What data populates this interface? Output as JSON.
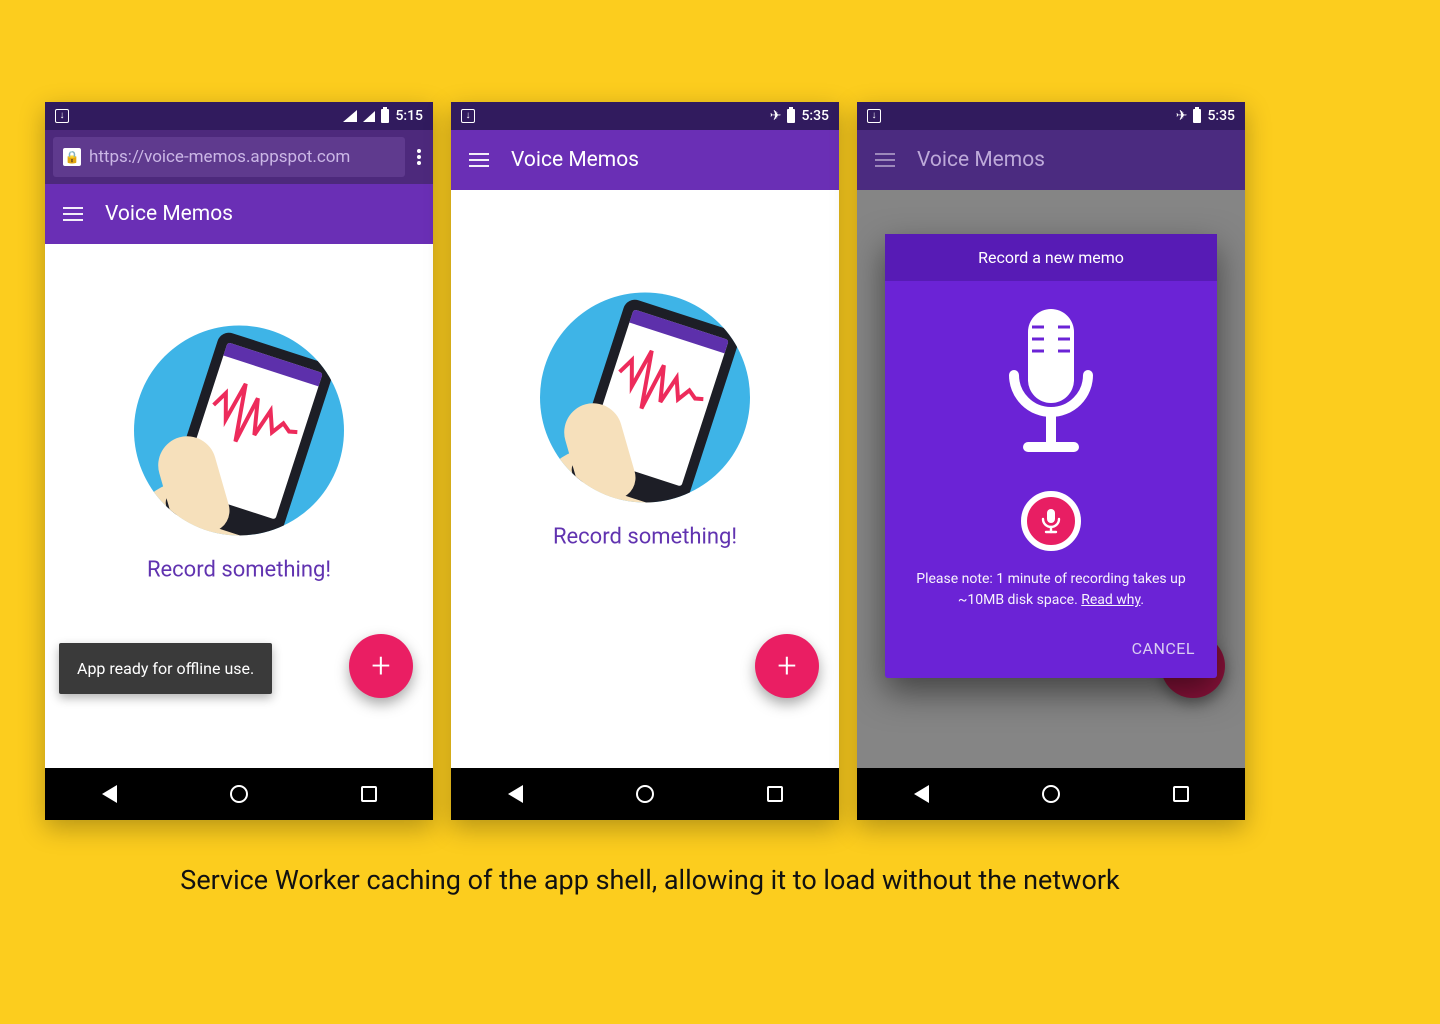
{
  "colors": {
    "canvas_bg": "#fccd1e",
    "statusbar_bg": "#311b5e",
    "urlbar_bg": "#4d297c",
    "omnibox_bg": "#5f3a8e",
    "appbar_bg": "#6a2fb5",
    "appbar_dim_bg": "#4b2b80",
    "content_dim_bg": "#858585",
    "circle_bg": "#3eb4e7",
    "prompt_text": "#6133b0",
    "fab_bg": "#ea1e63",
    "toast_bg": "#3a3a3a",
    "modal_bg": "#6b23d6",
    "modal_head_bg": "#571bb5",
    "record_btn_bg": "#e81e63"
  },
  "caption": "Service Worker caching of the app shell, allowing it to load without the network",
  "app_title": "Voice Memos",
  "prompt_text": "Record something!",
  "url": "https://voice-memos.appspot.com",
  "toast_text": "App ready for offline use.",
  "status": {
    "phone1_time": "5:15",
    "phone2_time": "5:35",
    "phone3_time": "5:35"
  },
  "modal": {
    "title": "Record a new memo",
    "note_prefix": "Please note: 1 minute of recording takes up ~10MB disk space. ",
    "note_link": "Read why",
    "note_suffix": ".",
    "cancel": "CANCEL"
  }
}
